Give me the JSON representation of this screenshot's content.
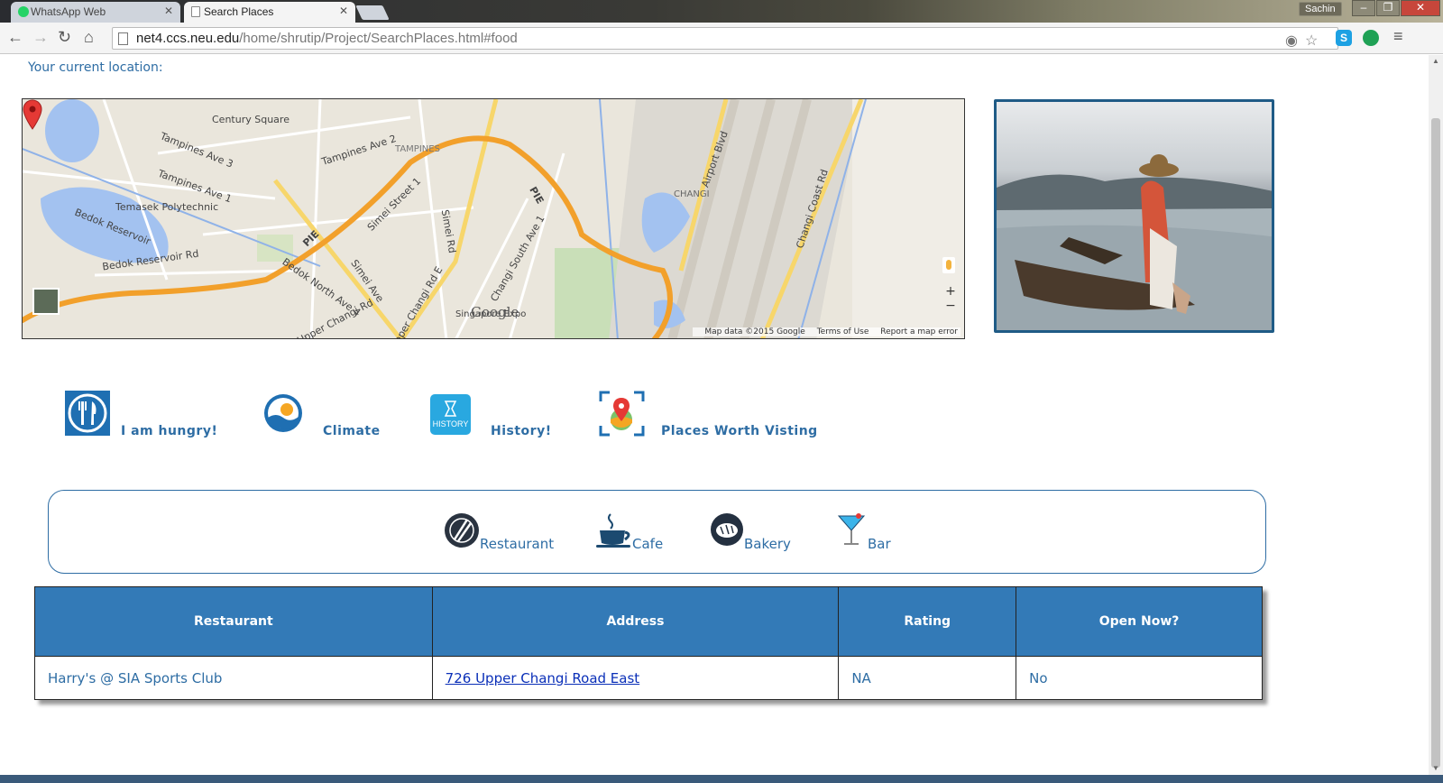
{
  "browser": {
    "tabs": [
      {
        "title": "WhatsApp Web",
        "active": false
      },
      {
        "title": "Search Places",
        "active": true
      }
    ],
    "user": "Sachin",
    "url_host": "net4.ccs.neu.edu",
    "url_path": "/home/shrutip/Project/SearchPlaces.html#food"
  },
  "location": {
    "label": "Your current location:"
  },
  "map": {
    "labels": {
      "century_square": "Century Square",
      "tampines_ave2": "Tampines Ave 2",
      "tampines": "TAMPINES",
      "tampines_ave1": "Tampines Ave 1",
      "tampines_ave3": "Tampines Ave 3",
      "temasek": "Temasek Polytechnic",
      "bedok_reservoir": "Bedok Reservoir",
      "bedok_reservoir_rd": "Bedok Reservoir Rd",
      "bedok_north_ave4": "Bedok North Ave 4",
      "simei_ave": "Simei Ave",
      "simei_street1": "Simei Street 1",
      "simei_rd": "Simei Rd",
      "upper_changi_rd_e": "Upper Changi Rd E",
      "upper_changi_rd": "Upper Changi Rd",
      "changi_south_ave1": "Changi South Ave 1",
      "singapore_expo": "Singapore Expo",
      "pie1": "PIE",
      "pie2": "PIE",
      "changi": "CHANGI",
      "airport_blvd": "Airport Blvd",
      "changi_coast_rd": "Changi Coast Rd"
    },
    "google": "Google",
    "credits": {
      "data": "Map data ©2015 Google",
      "terms": "Terms of Use",
      "report": "Report a map error"
    },
    "zoom_in": "+",
    "zoom_out": "−"
  },
  "categories": [
    {
      "label": "I am hungry!",
      "icon": "utensils-icon"
    },
    {
      "label": "Climate",
      "icon": "climate-icon"
    },
    {
      "label": "History!",
      "icon": "history-icon"
    },
    {
      "label": "Places Worth Visting",
      "icon": "places-map-pin-icon"
    }
  ],
  "history_icon_text": "HISTORY",
  "subcategories": [
    {
      "label": "Restaurant",
      "icon": "restaurant-icon"
    },
    {
      "label": "Cafe",
      "icon": "coffee-cup-icon"
    },
    {
      "label": "Bakery",
      "icon": "bread-icon"
    },
    {
      "label": "Bar",
      "icon": "cocktail-icon"
    }
  ],
  "results": {
    "headers": [
      "Restaurant",
      "Address",
      "Rating",
      "Open Now?"
    ],
    "rows": [
      {
        "name": "Harry's @ SIA Sports Club",
        "address": "726 Upper Changi Road East",
        "rating": "NA",
        "open": "No"
      }
    ]
  },
  "colors": {
    "accent": "#2e6da4",
    "table_header": "#337ab7",
    "route_orange": "#f2a02b",
    "map_bg": "#eae6dc"
  }
}
